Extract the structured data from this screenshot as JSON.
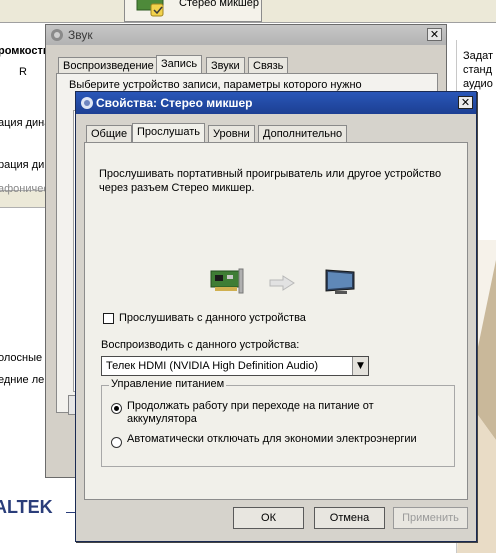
{
  "background": {
    "top_tab_label": "Стерео микшер",
    "left_text": [
      "ромкость",
      "R",
      "ация дина",
      "рация ди",
      "афоничес",
      "олосные",
      "едние ле"
    ],
    "right_text": [
      "Задат",
      "станд",
      "аудио"
    ],
    "brand": "ALTEK"
  },
  "sound_window": {
    "title": "Звук",
    "tabs": [
      "Воспроизведение",
      "Запись",
      "Звуки",
      "Связь"
    ],
    "description": "Выберите устройство записи, параметры которого нужно"
  },
  "properties_dialog": {
    "title": "Свойства: Стерео микшер",
    "tabs": [
      "Общие",
      "Прослушать",
      "Уровни",
      "Дополнительно"
    ],
    "selected_tab": "Прослушать",
    "description": "Прослушивать портативный проигрыватель или другое устройство через разъем Стерео микшер.",
    "listen_checkbox": {
      "label": "Прослушивать с данного устройства",
      "checked": false
    },
    "playback_label": "Воспроизводить с данного устройства:",
    "playback_device": "Телек HDMI (NVIDIA High Definition Audio)",
    "power_group": {
      "legend": "Управление питанием",
      "options": [
        {
          "label": "Продолжать работу при переходе на питание от аккумулятора",
          "selected": true
        },
        {
          "label": "Автоматически отключать для экономии электроэнергии",
          "selected": false
        }
      ]
    },
    "buttons": {
      "ok": "ОК",
      "cancel": "Отмена",
      "apply": "Применить"
    }
  },
  "icons": {
    "close": "close-icon",
    "sound_card": "sound-card-icon",
    "arrow": "arrow-right-icon",
    "monitor": "monitor-icon"
  },
  "colors": {
    "title_active": "#1c3f93",
    "title_inactive": "#b3b3b3",
    "dialog_bg": "#d6d3cc",
    "brand": "#2a3d7a"
  }
}
